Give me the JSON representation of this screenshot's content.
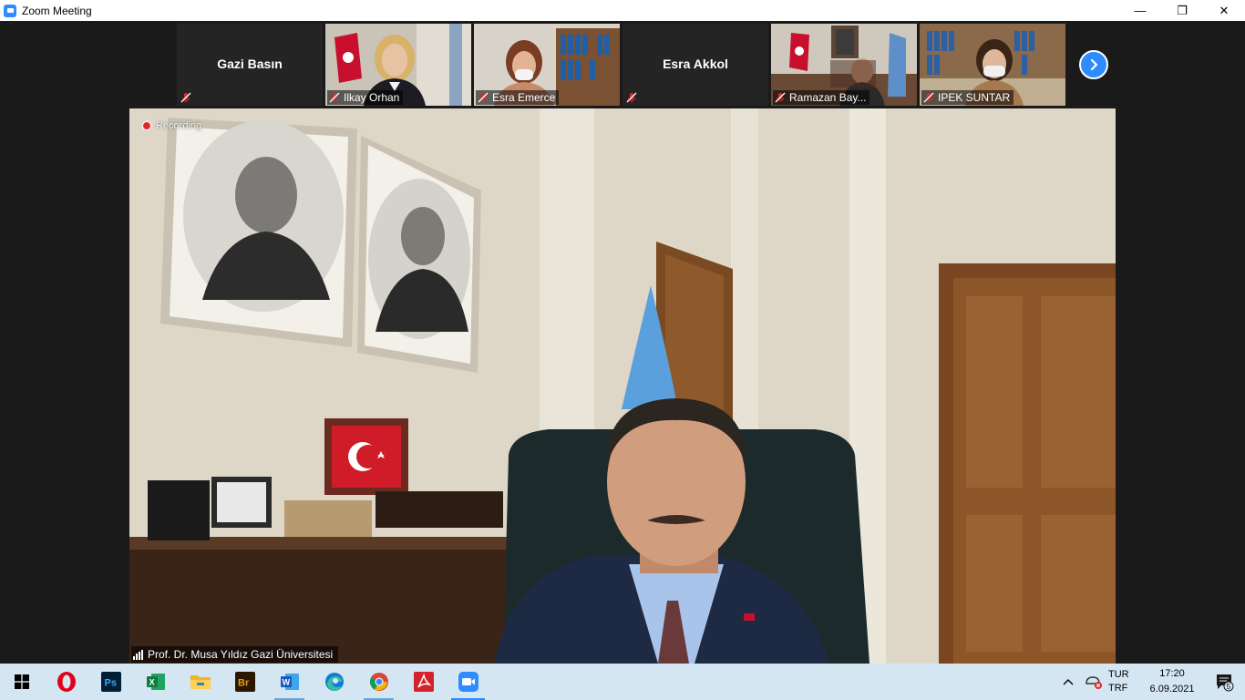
{
  "window": {
    "title": "Zoom Meeting",
    "minimize": "—",
    "maximize": "❐",
    "close": "✕"
  },
  "participants": [
    {
      "name": "Gazi Basın",
      "video": false
    },
    {
      "name": "Ilkay Orhan",
      "video": true
    },
    {
      "name": "Esra Emerce",
      "video": true
    },
    {
      "name": "Esra Akkol",
      "video": false
    },
    {
      "name": "Ramazan Bay...",
      "video": true
    },
    {
      "name": "IPEK SUNTAR",
      "video": true
    }
  ],
  "main": {
    "recording_label": "Recording",
    "speaker_name": "Prof. Dr. Musa Yıldız Gazi Üniversitesi"
  },
  "taskbar": {
    "apps": [
      {
        "name": "opera-icon",
        "color": "#e1001a"
      },
      {
        "name": "photoshop-icon",
        "color": "#001e36",
        "text": "Ps"
      },
      {
        "name": "excel-icon",
        "color": "#1d6f42",
        "text": "X"
      },
      {
        "name": "file-explorer-icon",
        "color": "#f5c242"
      },
      {
        "name": "bridge-icon",
        "color": "#2b1600",
        "text": "Br"
      },
      {
        "name": "word-icon",
        "color": "#2b579a",
        "text": "W"
      },
      {
        "name": "edge-icon",
        "color": "#0f7bd6"
      },
      {
        "name": "chrome-icon",
        "color": "#db4437"
      },
      {
        "name": "acrobat-icon",
        "color": "#d4222a"
      },
      {
        "name": "zoom-icon",
        "color": "#2d8cff"
      }
    ],
    "language_top": "TUR",
    "language_bottom": "TRF",
    "time": "17:20",
    "date": "6.09.2021",
    "notification_count": "5"
  }
}
